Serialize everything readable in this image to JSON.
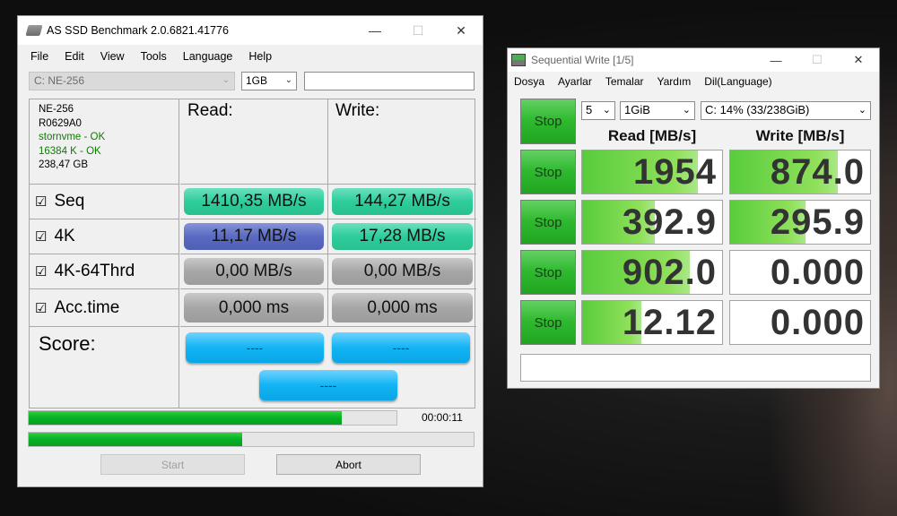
{
  "asssd": {
    "title": "AS SSD Benchmark 2.0.6821.41776",
    "menu": [
      "File",
      "Edit",
      "View",
      "Tools",
      "Language",
      "Help"
    ],
    "drive": "C: NE-256",
    "size": "1GB",
    "info": {
      "model": "NE-256",
      "firmware": "R0629A0",
      "driver": "stornvme - OK",
      "alignment": "16384 K - OK",
      "capacity": "238,47 GB"
    },
    "read_label": "Read:",
    "write_label": "Write:",
    "rows": [
      {
        "label": "Seq",
        "read": "1410,35 MB/s",
        "write": "144,27 MB/s"
      },
      {
        "label": "4K",
        "read": "11,17 MB/s",
        "write": "17,28 MB/s"
      },
      {
        "label": "4K-64Thrd",
        "read": "0,00 MB/s",
        "write": "0,00 MB/s"
      },
      {
        "label": "Acc.time",
        "read": "0,000 ms",
        "write": "0,000 ms"
      }
    ],
    "score_label": "Score:",
    "score_read": "----",
    "score_write": "----",
    "score_total": "----",
    "progress_main": 0.85,
    "progress_sub": 0.48,
    "elapsed": "00:00:11",
    "start_label": "Start",
    "abort_label": "Abort"
  },
  "cdm": {
    "title": "Sequential Write [1/5]",
    "menu": [
      "Dosya",
      "Ayarlar",
      "Temalar",
      "Yardım",
      "Dil(Language)"
    ],
    "count": "5",
    "size": "1GiB",
    "drive": "C: 14% (33/238GiB)",
    "stop_label": "Stop",
    "read_header": "Read [MB/s]",
    "write_header": "Write [MB/s]",
    "rows": [
      {
        "read": "1954",
        "write": "874.0",
        "read_fill": 0.83,
        "write_fill": 0.77
      },
      {
        "read": "392.9",
        "write": "295.9",
        "read_fill": 0.52,
        "write_fill": 0.54
      },
      {
        "read": "902.0",
        "write": "0.000",
        "read_fill": 0.77,
        "write_fill": 0
      },
      {
        "read": "12.12",
        "write": "0.000",
        "read_fill": 0.42,
        "write_fill": 0
      }
    ]
  }
}
